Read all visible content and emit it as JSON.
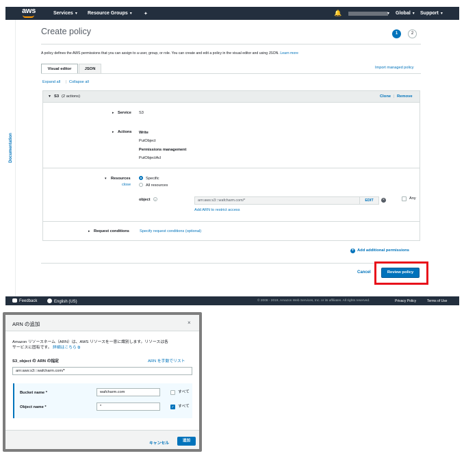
{
  "nav": {
    "logo": "aws",
    "services": "Services",
    "resource_groups": "Resource Groups",
    "region": "Global",
    "support": "Support"
  },
  "doc_rail": {
    "label": "Documentation"
  },
  "page": {
    "title": "Create policy",
    "step1": "1",
    "step2": "2",
    "description": "A policy defines the AWS permissions that you can assign to a user, group, or role. You can create and edit a policy in the visual editor and using JSON.",
    "learn_more": "Learn more",
    "tab_visual": "Visual editor",
    "tab_json": "JSON",
    "import_managed": "Import managed policy",
    "expand_all": "Expand all",
    "collapse_all": "Collapse all"
  },
  "service_block": {
    "heading": "S3",
    "heading_count": "(2 actions)",
    "clone": "Clone",
    "remove": "Remove",
    "service_label": "Service",
    "service_value": "S3",
    "actions_label": "Actions",
    "actions": [
      {
        "group": "Write",
        "item": "PutObject"
      },
      {
        "group": "Permissions management",
        "item": "PutObjectAcl"
      }
    ],
    "resources_label": "Resources",
    "resources_close": "close",
    "opt_specific": "Specific",
    "opt_all": "All resources",
    "object_label": "object",
    "object_arn": "arn:aws:s3:::wafcharm.com/*",
    "edit": "EDIT",
    "any": "Any",
    "add_arn": "Add ARN to restrict access",
    "request_conditions_label": "Request conditions",
    "request_conditions_link": "Specify request conditions (optional)"
  },
  "add_additional": "Add additional permissions",
  "actions_bar": {
    "cancel": "Cancel",
    "review": "Review policy"
  },
  "footer": {
    "feedback": "Feedback",
    "language": "English (US)",
    "copyright": "© 2008 - 2019, Amazon Web Services, Inc. or its affiliates. All rights reserved.",
    "privacy": "Privacy Policy",
    "terms": "Terms of Use"
  },
  "dialog": {
    "title": "ARN の追加",
    "close": "×",
    "intro_line1": "Amazon リソースネーム（ARN）は、AWS リソースを一意に識別します。リソースは各",
    "intro_line2": "サービスに固有です。",
    "details_link": "詳細はこちら",
    "arn_label": "S3_object の ARN の指定",
    "manual_link": "ARN を手動でリスト",
    "arn_value": "arn:aws:s3:::wafcharm.com/*",
    "bucket_label": "Bucket name *",
    "bucket_value": "wafcharm.com",
    "bucket_all": "すべて",
    "object_label": "Object name *",
    "object_value": "*",
    "object_all": "すべて",
    "cancel": "キャンセル",
    "add": "追加"
  }
}
